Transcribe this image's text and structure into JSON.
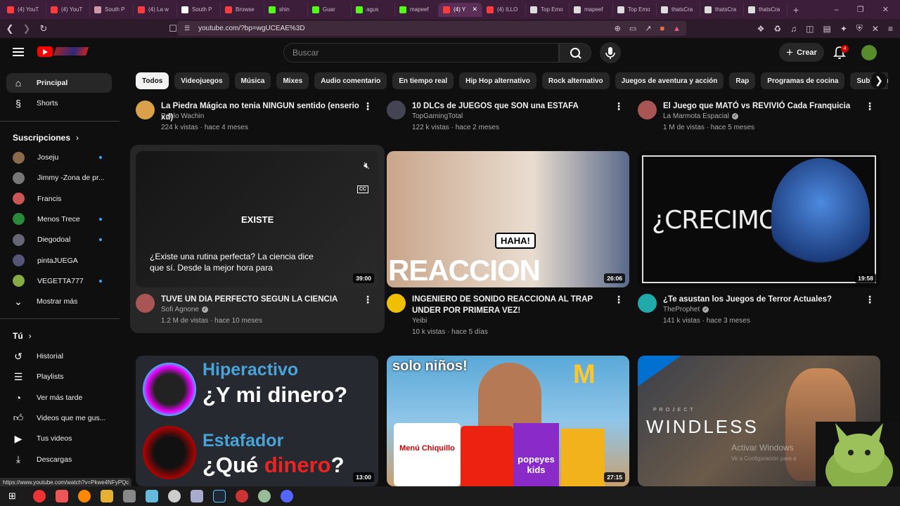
{
  "browser": {
    "tabs": [
      {
        "label": "(4) YouT",
        "color": "#ff3b3b"
      },
      {
        "label": "(4) YouT",
        "color": "#ff3b3b"
      },
      {
        "label": "South P",
        "color": "#c9a"
      },
      {
        "label": "(4) La w",
        "color": "#ff3b3b"
      },
      {
        "label": "South P",
        "color": "#fff"
      },
      {
        "label": "Browse",
        "color": "#ff3b3b"
      },
      {
        "label": "shin",
        "color": "#53fc18"
      },
      {
        "label": "Guar",
        "color": "#53fc18"
      },
      {
        "label": "agus",
        "color": "#53fc18"
      },
      {
        "label": "mapeef",
        "color": "#53fc18"
      },
      {
        "label": "(4) Y",
        "color": "#ff3b3b",
        "active": true
      },
      {
        "label": "(4) ILLO",
        "color": "#ff3b3b"
      },
      {
        "label": "Top Emo",
        "color": "#ddd"
      },
      {
        "label": "mapeef",
        "color": "#ddd"
      },
      {
        "label": "Top Emo",
        "color": "#ddd"
      },
      {
        "label": "thatsCra",
        "color": "#ddd"
      },
      {
        "label": "thatsCra",
        "color": "#ddd"
      },
      {
        "label": "thatsCra",
        "color": "#ddd"
      }
    ],
    "url": "youtube.com/?bp=wgUCEAE%3D",
    "status_url": "https://www.youtube.com/watch?v=Pkwe4NFyPQc"
  },
  "header": {
    "search_placeholder": "Buscar",
    "create_label": "Crear",
    "notification_count": "4"
  },
  "sidebar": {
    "main": [
      {
        "label": "Principal",
        "icon": "home-icon"
      },
      {
        "label": "Shorts",
        "icon": "shorts-icon"
      }
    ],
    "subscriptions_title": "Suscripciones",
    "subscriptions": [
      {
        "label": "Joseju",
        "dot": true,
        "color": "#8a6a4a"
      },
      {
        "label": "Jimmy -Zona de pr...",
        "dot": false,
        "color": "#777"
      },
      {
        "label": "Francis",
        "dot": false,
        "color": "#c55"
      },
      {
        "label": "Menos Trece",
        "dot": true,
        "color": "#2a8a3a"
      },
      {
        "label": "Diegodoal",
        "dot": true,
        "color": "#667"
      },
      {
        "label": "pintaJUEGA",
        "dot": false,
        "color": "#557"
      },
      {
        "label": "VEGETTA777",
        "dot": true,
        "color": "#8a4"
      }
    ],
    "show_more": "Mostrar más",
    "you_title": "Tú",
    "you_items": [
      {
        "label": "Historial",
        "icon": "history-icon"
      },
      {
        "label": "Playlists",
        "icon": "playlists-icon"
      },
      {
        "label": "Ver más tarde",
        "icon": "clock-icon"
      },
      {
        "label": "Videos que me gus...",
        "icon": "thumbs-up-icon"
      },
      {
        "label": "Tus videos",
        "icon": "play-icon"
      },
      {
        "label": "Descargas",
        "icon": "download-icon"
      }
    ]
  },
  "chips": [
    "Todos",
    "Videojuegos",
    "Música",
    "Mixes",
    "Audio comentario",
    "En tiempo real",
    "Hip Hop alternativo",
    "Rock alternativo",
    "Juegos de aventura y acción",
    "Rap",
    "Programas de cocina",
    "Subidos r"
  ],
  "videos_top": [
    {
      "title": "La Piedra Mágica no tenia NINGUN sentido (enserio xd)",
      "channel": "Paulo Wachin",
      "stats": "224 k vistas · hace 4 meses",
      "verified": false,
      "avatar": "#d9a24a"
    },
    {
      "title": "10 DLCs de JUEGOS que SON una ESTAFA",
      "channel": "TopGamingTotal",
      "stats": "122 k vistas · hace 2 meses",
      "verified": false,
      "avatar": "#445"
    },
    {
      "title": "El Juego que MATÓ vs REVIVIÓ Cada Franquicia",
      "channel": "La Marmota Espacial",
      "stats": "1 M de vistas · hace 5 meses",
      "verified": true,
      "avatar": "#a55"
    }
  ],
  "videos_mid": [
    {
      "title": "TUVE UN DIA PERFECTO SEGUN LA CIENCIA",
      "channel": "Sofi Agnone",
      "stats": "1.2 M de vistas · hace 10 meses",
      "verified": true,
      "duration": "39:00",
      "avatar": "#a55",
      "thumb_word": "EXISTE",
      "caption": "¿Existe una rutina perfecta? La ciencia dice que sí. Desde la mejor hora para"
    },
    {
      "title": "INGENIERO DE SONIDO REACCIONA AL TRAP UNDER POR PRIMERA VEZ!",
      "channel": "Yeibi",
      "stats": "10 k vistas · hace 5 días",
      "verified": false,
      "duration": "26:06",
      "avatar": "#f0c000",
      "thumb_word": "REACCION",
      "thumb_tag": "HAHA!"
    },
    {
      "title": "¿Te asustan los Juegos de Terror Actuales?",
      "channel": "TheProphet",
      "stats": "141 k vistas · hace 3 meses",
      "verified": true,
      "duration": "19:58",
      "avatar": "#2aa",
      "thumb_word": "¿CRECIMOS?"
    }
  ],
  "videos_bottom": [
    {
      "duration": "13:00",
      "line1": "Hiperactivo",
      "line2": "¿Y mi dinero?",
      "line3": "Estafador",
      "line4a": "¿Qué ",
      "line4b": "dinero",
      "line4c": "?"
    },
    {
      "duration": "27:15",
      "tag": "solo niños!",
      "box1": "Menú Chiquillo",
      "box2": "popeyes kids"
    },
    {
      "brand": "PROJECT",
      "title": "WINDLESS"
    }
  ],
  "overlay": {
    "activate_title": "Activar Windows",
    "activate_sub": "Ve a Configuración para a"
  }
}
